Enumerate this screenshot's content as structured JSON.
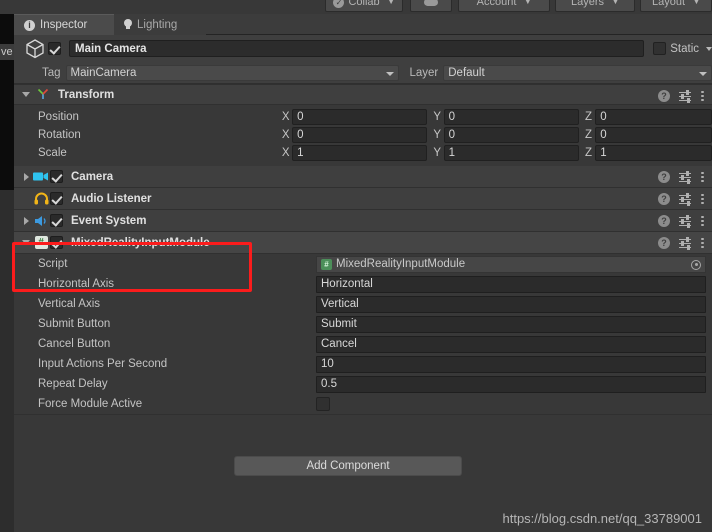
{
  "toolbar": {
    "collab_label": "Collab",
    "collab_icon": "cloud-check-icon",
    "cloud_icon": "cloud-icon",
    "account_label": "Account",
    "layers_label": "Layers",
    "layout_label": "Layout"
  },
  "hierarchy_sliver": {
    "clipped_text": "ve"
  },
  "tabs": [
    {
      "label": "Inspector",
      "icon": "info-icon",
      "active": true
    },
    {
      "label": "Lighting",
      "icon": "lightbulb-icon",
      "active": false
    }
  ],
  "header": {
    "enabled": true,
    "object_icon": "cube-icon",
    "name": "Main Camera",
    "static_label": "Static",
    "static_checked": false,
    "tag_label": "Tag",
    "tag_value": "MainCamera",
    "layer_label": "Layer",
    "layer_value": "Default"
  },
  "transform": {
    "title": "Transform",
    "icon": "transform-axis-icon",
    "expanded": true,
    "rows": [
      {
        "label": "Position",
        "x": "0",
        "y": "0",
        "z": "0"
      },
      {
        "label": "Rotation",
        "x": "0",
        "y": "0",
        "z": "0"
      },
      {
        "label": "Scale",
        "x": "1",
        "y": "1",
        "z": "1"
      }
    ],
    "axis_labels": {
      "x": "X",
      "y": "Y",
      "z": "Z"
    }
  },
  "components": [
    {
      "title": "Camera",
      "icon": "camera-icon",
      "icon_color": "#2fc4f0",
      "enabled": true,
      "foldout": "right"
    },
    {
      "title": "Audio Listener",
      "icon": "headphones-icon",
      "icon_color": "#f2b518",
      "enabled": true,
      "foldout": "none"
    },
    {
      "title": "Event System",
      "icon": "speaker-icon",
      "icon_color": "#3c9ae0",
      "enabled": true,
      "foldout": "right"
    }
  ],
  "script_component": {
    "title": "MixedRealityInputModule",
    "icon": "script-hash-icon",
    "enabled": true,
    "expanded": true,
    "highlighted": true,
    "highlight_color": "#fb1c1c",
    "script_row": {
      "label": "Script",
      "value": "MixedRealityInputModule",
      "picker_icon": "object-picker-icon"
    },
    "properties": [
      {
        "label": "Horizontal Axis",
        "type": "text",
        "value": "Horizontal"
      },
      {
        "label": "Vertical Axis",
        "type": "text",
        "value": "Vertical"
      },
      {
        "label": "Submit Button",
        "type": "text",
        "value": "Submit"
      },
      {
        "label": "Cancel Button",
        "type": "text",
        "value": "Cancel"
      },
      {
        "label": "Input Actions Per Second",
        "type": "text",
        "value": "10"
      },
      {
        "label": "Repeat Delay",
        "type": "text",
        "value": "0.5"
      },
      {
        "label": "Force Module Active",
        "type": "bool",
        "value": false
      }
    ]
  },
  "footer": {
    "add_component_label": "Add Component",
    "watermark": "https://blog.csdn.net/qq_33789001"
  },
  "header_icons": {
    "help": "help-icon",
    "preset": "preset-sliders-icon",
    "menu": "kebab-menu-icon"
  }
}
